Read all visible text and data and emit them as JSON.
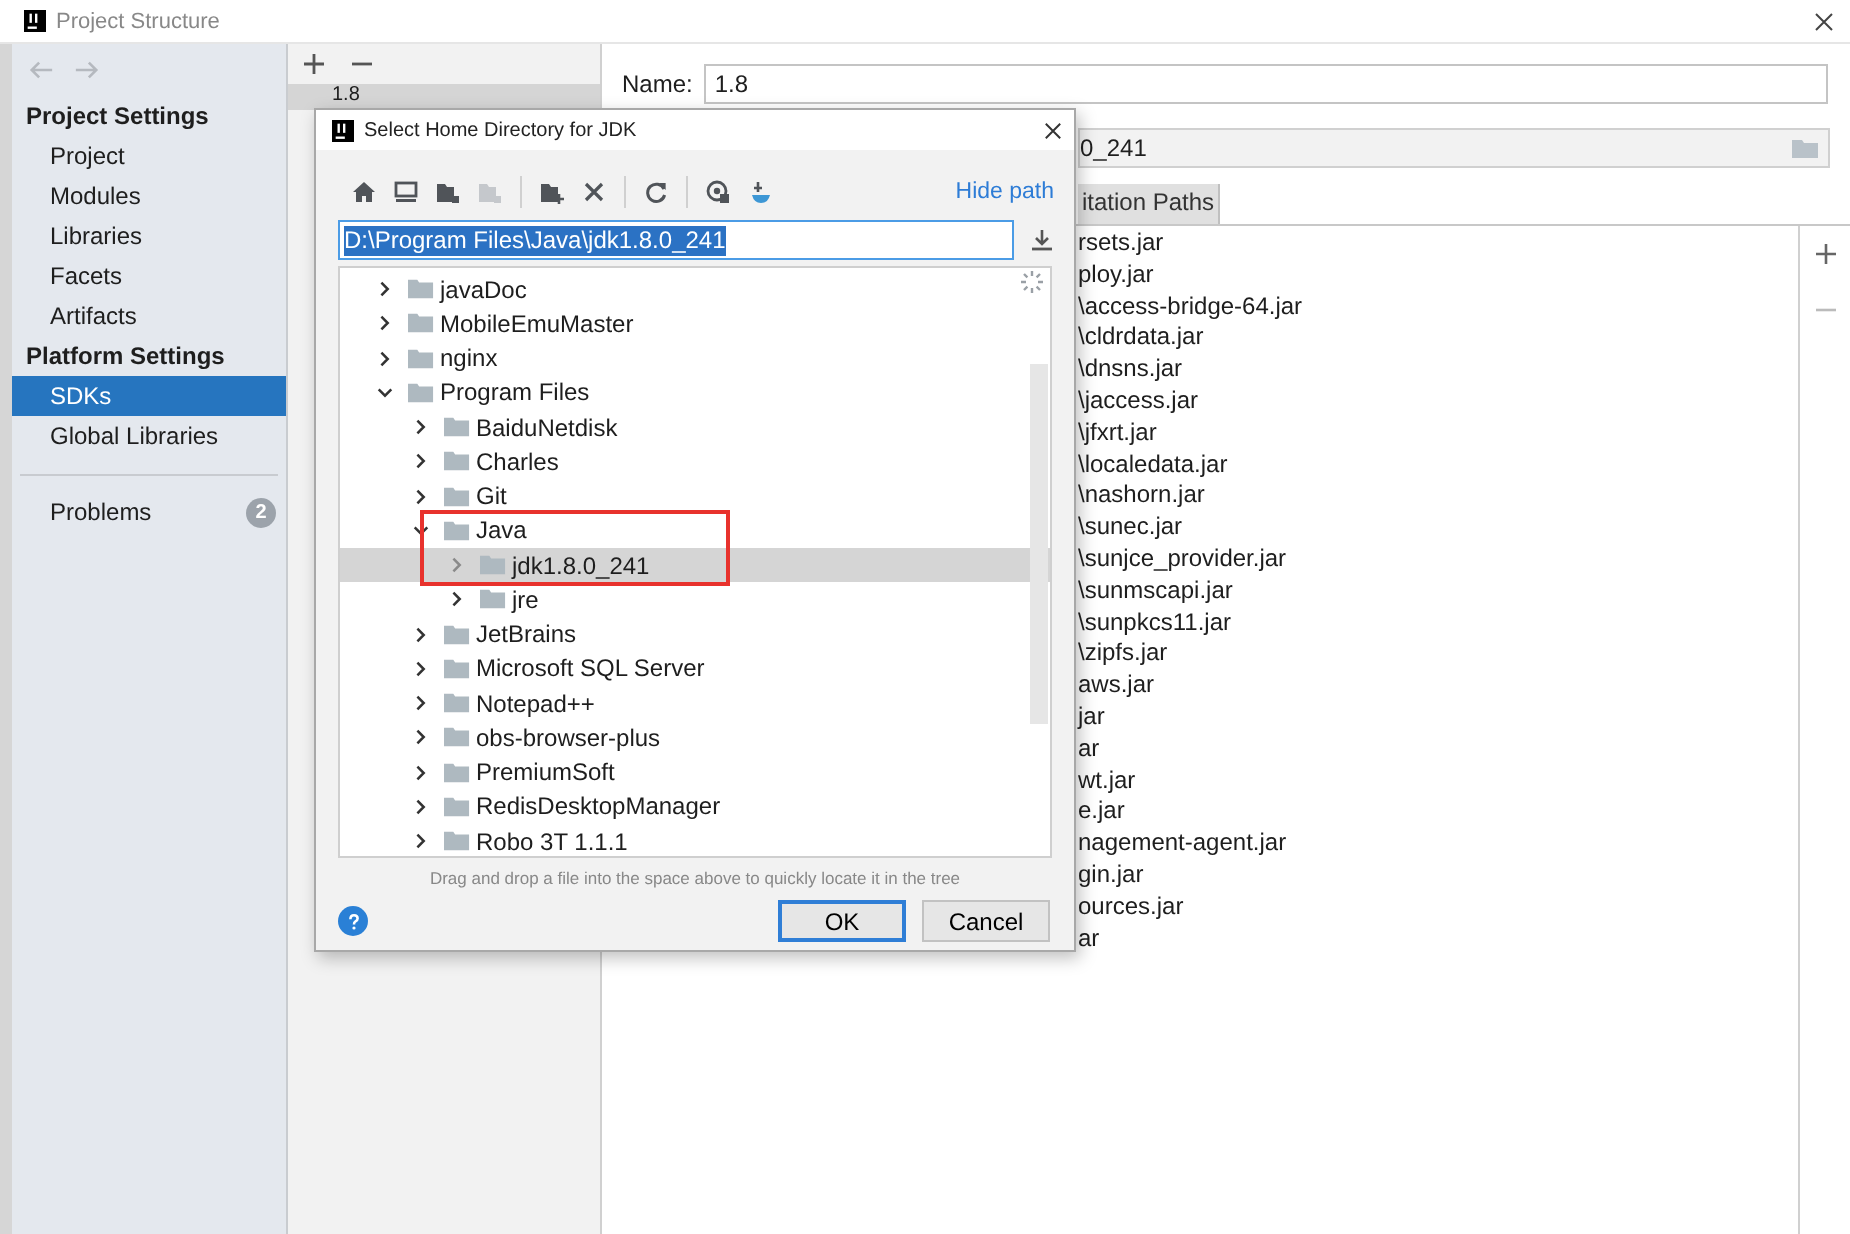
{
  "window": {
    "title": "Project Structure"
  },
  "sidebar": {
    "sections": [
      {
        "heading": "Project Settings",
        "items": [
          {
            "label": "Project",
            "selected": false
          },
          {
            "label": "Modules",
            "selected": false
          },
          {
            "label": "Libraries",
            "selected": false
          },
          {
            "label": "Facets",
            "selected": false
          },
          {
            "label": "Artifacts",
            "selected": false
          }
        ]
      },
      {
        "heading": "Platform Settings",
        "items": [
          {
            "label": "SDKs",
            "selected": true
          },
          {
            "label": "Global Libraries",
            "selected": false
          }
        ]
      }
    ],
    "problems": {
      "label": "Problems",
      "count": "2"
    }
  },
  "sdk_list": {
    "items": [
      {
        "label": "1.8",
        "selected": true
      }
    ]
  },
  "details": {
    "name_label": "Name:",
    "name_value": "1.8",
    "home_path_value": "0_241",
    "tabs": [
      {
        "label": "itation Paths",
        "selected": true
      }
    ],
    "paths": [
      "rsets.jar",
      "ploy.jar",
      "\\access-bridge-64.jar",
      "\\cldrdata.jar",
      "\\dnsns.jar",
      "\\jaccess.jar",
      "\\jfxrt.jar",
      "\\localedata.jar",
      "\\nashorn.jar",
      "\\sunec.jar",
      "\\sunjce_provider.jar",
      "\\sunmscapi.jar",
      "\\sunpkcs11.jar",
      "\\zipfs.jar",
      "aws.jar",
      "jar",
      "ar",
      "wt.jar",
      "e.jar",
      "nagement-agent.jar",
      "gin.jar",
      "ources.jar",
      "ar"
    ]
  },
  "dialog": {
    "title": "Select Home Directory for JDK",
    "hide_path_link": "Hide path",
    "path_value": "D:\\Program Files\\Java\\jdk1.8.0_241",
    "tree": [
      {
        "label": "javaDoc",
        "expanded": false,
        "selected": false
      },
      {
        "label": "MobileEmuMaster",
        "expanded": false,
        "selected": false
      },
      {
        "label": "nginx",
        "expanded": false,
        "selected": false
      },
      {
        "label": "Program Files",
        "expanded": true,
        "selected": false,
        "children": [
          {
            "label": "BaiduNetdisk",
            "expanded": false,
            "selected": false
          },
          {
            "label": "Charles",
            "expanded": false,
            "selected": false
          },
          {
            "label": "Git",
            "expanded": false,
            "selected": false
          },
          {
            "label": "Java",
            "expanded": true,
            "selected": false,
            "children": [
              {
                "label": "jdk1.8.0_241",
                "expanded": false,
                "selected": true
              },
              {
                "label": "jre",
                "expanded": false,
                "selected": false
              }
            ]
          },
          {
            "label": "JetBrains",
            "expanded": false,
            "selected": false
          },
          {
            "label": "Microsoft SQL Server",
            "expanded": false,
            "selected": false
          },
          {
            "label": "Notepad++",
            "expanded": false,
            "selected": false
          },
          {
            "label": "obs-browser-plus",
            "expanded": false,
            "selected": false
          },
          {
            "label": "PremiumSoft",
            "expanded": false,
            "selected": false
          },
          {
            "label": "RedisDesktopManager",
            "expanded": false,
            "selected": false
          },
          {
            "label": "Robo 3T 1.1.1",
            "expanded": false,
            "selected": false
          }
        ]
      }
    ],
    "hint": "Drag and drop a file into the space above to quickly locate it in the tree",
    "buttons": [
      {
        "label": "OK",
        "kind": "primary"
      },
      {
        "label": "Cancel",
        "kind": "secondary"
      }
    ]
  }
}
